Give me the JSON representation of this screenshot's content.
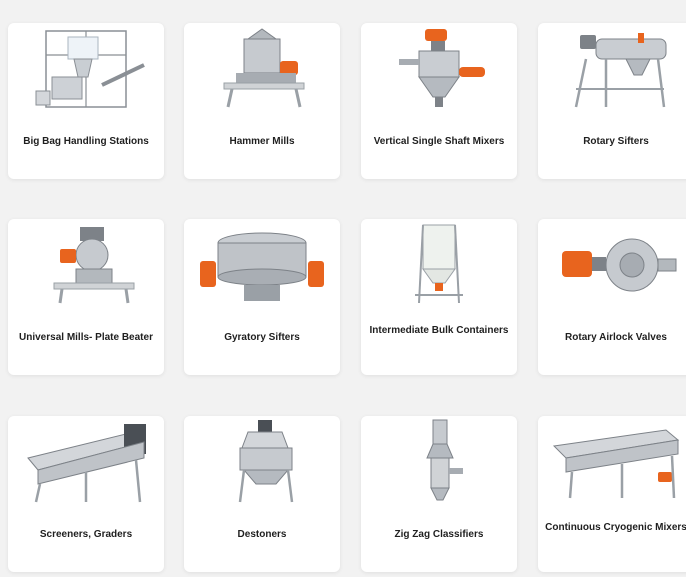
{
  "products": [
    {
      "label": "Big Bag Handling Stations",
      "icon": "big-bag-station-icon"
    },
    {
      "label": "Hammer Mills",
      "icon": "hammer-mill-icon"
    },
    {
      "label": "Vertical Single Shaft Mixers",
      "icon": "vertical-mixer-icon"
    },
    {
      "label": "Rotary Sifters",
      "icon": "rotary-sifter-icon"
    },
    {
      "label": "Universal Mills- Plate Beater",
      "icon": "universal-mill-icon"
    },
    {
      "label": "Gyratory Sifters",
      "icon": "gyratory-sifter-icon"
    },
    {
      "label": "Intermediate Bulk Containers",
      "icon": "bulk-container-icon"
    },
    {
      "label": "Rotary Airlock Valves",
      "icon": "airlock-valve-icon"
    },
    {
      "label": "Screeners, Graders",
      "icon": "screener-icon"
    },
    {
      "label": "Destoners",
      "icon": "destoner-icon"
    },
    {
      "label": "Zig Zag Classifiers",
      "icon": "zigzag-classifier-icon"
    },
    {
      "label": "Continuous Cryogenic Mixers",
      "icon": "cryogenic-mixer-icon"
    }
  ],
  "colors": {
    "background": "#f2f2f2",
    "card": "#ffffff",
    "steel": "#b9bdc2",
    "steel_dark": "#7d8288",
    "motor_orange": "#e8641e",
    "text": "#1f1f1f"
  }
}
